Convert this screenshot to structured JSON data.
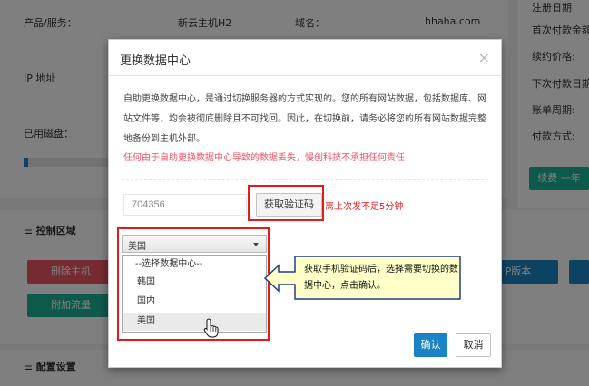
{
  "background": {
    "product_label": "产品/服务：",
    "product_value": "新云主机H2",
    "domain_label": "域名：",
    "domain_value": "hhaha.com",
    "ip_label": "IP 地址",
    "disk_label": "已用磁盘：",
    "control_section": "控制区域",
    "config_section": "配置设置",
    "right_items": [
      "注册日期",
      "首次付款金额",
      "续约价格:",
      "下次付款日期",
      "账单周期:",
      "付款方式:"
    ],
    "renew_button": "续费 一年",
    "delete_button": "删除主机",
    "add_traffic_button": "附加流量",
    "ip_version_button": "P版本"
  },
  "modal": {
    "title": "更换数据中心",
    "close": "×",
    "description": "自助更换数据中心，是通过切换服务器的方式实现的。您的所有网站数据，包括数据库、网站文件等，均会被彻底删除且不可找回。因此，在切换前，请务必将您的所有网站数据完整地备份到主机外部。",
    "warning": "任何由于自助更换数据中心导致的数据丢失，慢创科技不承担任何责任",
    "code_input_value": "704356",
    "code_button": "获取验证码",
    "code_tip": "离上次发不足5分钟",
    "select_value": "美国",
    "options": [
      "--选择数据中心--",
      "韩国",
      "国内",
      "美国"
    ],
    "confirm_button": "确认",
    "cancel_button": "取消"
  },
  "annotation": {
    "text": "获取手机验证码后，选择需要切换的数据中心，点击确认。"
  },
  "colors": {
    "primary": "#1c84c6",
    "danger": "#ed5565",
    "annotation_red": "#e31a1a",
    "callout_fill": "#ffffc7",
    "callout_border": "#1f3f8f"
  }
}
